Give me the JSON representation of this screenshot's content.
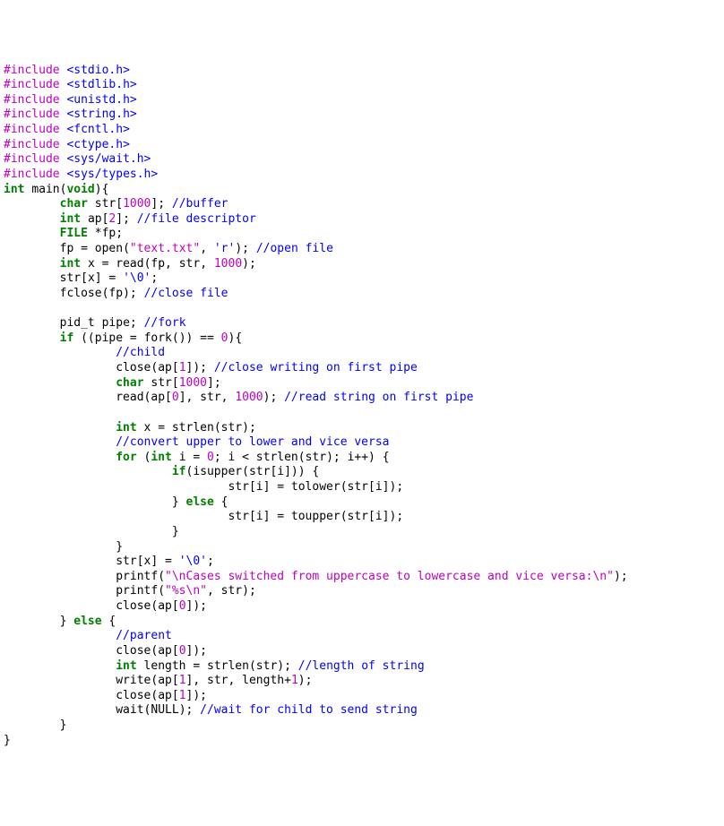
{
  "c": {
    "inc": "#include",
    "h": {
      "stdio": "<stdio.h>",
      "stdlib": "<stdlib.h>",
      "unistd": "<unistd.h>",
      "string": "<string.h>",
      "fcntl": "<fcntl.h>",
      "ctype": "<ctype.h>",
      "syswait": "<sys/wait.h>",
      "systypes": "<sys/types.h>"
    },
    "kw": {
      "int": "int",
      "char": "char",
      "void": "void",
      "for": "for",
      "if": "if",
      "else": "else",
      "FILE": "FILE"
    },
    "id": {
      "main": "main",
      "str": "str",
      "ap": "ap",
      "fp": "fp",
      "open": "open",
      "read": "read",
      "fclose": "fclose",
      "pid_t": "pid_t",
      "pipe": "pipe",
      "fork": "fork",
      "close": "close",
      "strlen": "strlen",
      "isupper": "isupper",
      "tolower": "tolower",
      "toupper": "toupper",
      "printf": "printf",
      "write": "write",
      "wait": "wait",
      "length": "length",
      "x": "x",
      "i": "i",
      "NULL": "NULL"
    },
    "n": {
      "1000": "1000",
      "2": "2",
      "0": "0",
      "1": "1"
    },
    "ch": {
      "nul": "'\\0'",
      "r": "'r'"
    },
    "s": {
      "text": "\"text.txt\"",
      "cases": "\"\\nCases switched from uppercase to lowercase and vice versa:\\n\"",
      "pct": "\"%s\\n\""
    },
    "cm": {
      "buffer": "//buffer",
      "fd": "//file descriptor",
      "open": "//open file",
      "close": "//close file",
      "fork": "//fork",
      "child": "//child",
      "closew": "//close writing on first pipe",
      "reads": "//read string on first pipe",
      "conv": "//convert upper to lower and vice versa",
      "parent": "//parent",
      "len": "//length of string",
      "wait": "//wait for child to send string"
    }
  }
}
